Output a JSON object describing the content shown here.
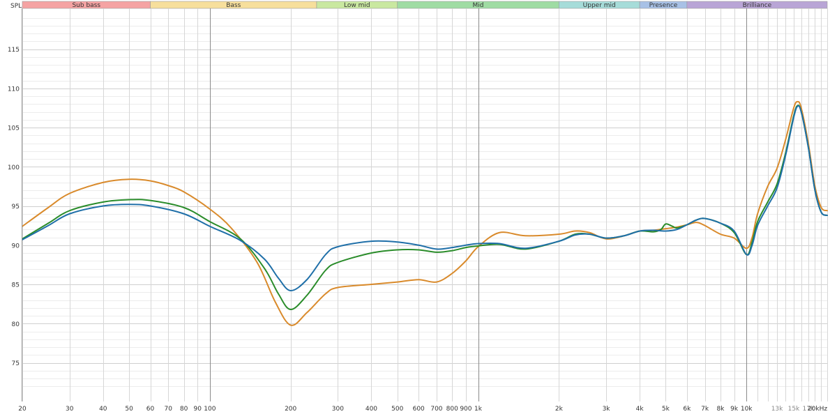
{
  "chart_data": {
    "type": "line",
    "ylabel": "SPL",
    "x_scale": "log",
    "xlim": [
      20,
      20000
    ],
    "ylim": [
      70,
      120
    ],
    "grid": true,
    "legend": "none",
    "bands": [
      {
        "label": "Sub bass",
        "from": 20,
        "to": 60,
        "color": "#f5a3a3"
      },
      {
        "label": "Bass",
        "from": 60,
        "to": 250,
        "color": "#f7df9c"
      },
      {
        "label": "Low mid",
        "from": 250,
        "to": 500,
        "color": "#c9e8a0"
      },
      {
        "label": "Mid",
        "from": 500,
        "to": 2000,
        "color": "#9fdca3"
      },
      {
        "label": "Upper mid",
        "from": 2000,
        "to": 4000,
        "color": "#a6dcd9"
      },
      {
        "label": "Presence",
        "from": 4000,
        "to": 6000,
        "color": "#a8c1e6"
      },
      {
        "label": "Brilliance",
        "from": 6000,
        "to": 20000,
        "color": "#b9a5d6"
      }
    ],
    "y_ticks": [
      {
        "value": 75,
        "label": "75"
      },
      {
        "value": 80,
        "label": "80"
      },
      {
        "value": 85,
        "label": "85"
      },
      {
        "value": 90,
        "label": "90"
      },
      {
        "value": 95,
        "label": "95"
      },
      {
        "value": 100,
        "label": "100"
      },
      {
        "value": 105,
        "label": "105"
      },
      {
        "value": 110,
        "label": "110"
      },
      {
        "value": 115,
        "label": "115"
      }
    ],
    "x_ticks": [
      {
        "value": 20,
        "label": "20"
      },
      {
        "value": 30,
        "label": "30"
      },
      {
        "value": 40,
        "label": "40"
      },
      {
        "value": 50,
        "label": "50"
      },
      {
        "value": 60,
        "label": "60"
      },
      {
        "value": 70,
        "label": "70"
      },
      {
        "value": 80,
        "label": "80"
      },
      {
        "value": 90,
        "label": "90"
      },
      {
        "value": 100,
        "label": "100"
      },
      {
        "value": 200,
        "label": "200"
      },
      {
        "value": 300,
        "label": "300"
      },
      {
        "value": 400,
        "label": "400"
      },
      {
        "value": 500,
        "label": "500"
      },
      {
        "value": 600,
        "label": "600"
      },
      {
        "value": 700,
        "label": "700"
      },
      {
        "value": 800,
        "label": "800"
      },
      {
        "value": 900,
        "label": "900"
      },
      {
        "value": 1000,
        "label": "1k"
      },
      {
        "value": 2000,
        "label": "2k"
      },
      {
        "value": 3000,
        "label": "3k"
      },
      {
        "value": 4000,
        "label": "4k"
      },
      {
        "value": 5000,
        "label": "5k"
      },
      {
        "value": 6000,
        "label": "6k"
      },
      {
        "value": 7000,
        "label": "7k"
      },
      {
        "value": 8000,
        "label": "8k"
      },
      {
        "value": 9000,
        "label": "9k"
      },
      {
        "value": 10000,
        "label": "10k"
      },
      {
        "value": 13000,
        "label": "13k",
        "light": true
      },
      {
        "value": 15000,
        "label": "15k",
        "light": true
      },
      {
        "value": 17000,
        "label": "17k",
        "light": true
      },
      {
        "value": 20000,
        "label": "20kHz"
      }
    ],
    "x_major_lines": [
      100,
      1000,
      10000
    ],
    "x_minor_lines": [
      11000,
      12000,
      13000,
      14000,
      15000,
      16000,
      17000,
      18000,
      19000
    ],
    "series": [
      {
        "color": "#d98a2b",
        "points": [
          [
            20,
            92.4
          ],
          [
            25,
            94.8
          ],
          [
            30,
            96.6
          ],
          [
            40,
            98.0
          ],
          [
            50,
            98.4
          ],
          [
            60,
            98.2
          ],
          [
            70,
            97.6
          ],
          [
            80,
            96.8
          ],
          [
            100,
            94.6
          ],
          [
            120,
            92.2
          ],
          [
            150,
            87.8
          ],
          [
            175,
            82.8
          ],
          [
            200,
            79.8
          ],
          [
            230,
            81.4
          ],
          [
            270,
            83.8
          ],
          [
            300,
            84.6
          ],
          [
            400,
            85.0
          ],
          [
            500,
            85.3
          ],
          [
            600,
            85.6
          ],
          [
            700,
            85.3
          ],
          [
            800,
            86.4
          ],
          [
            900,
            88.0
          ],
          [
            1000,
            89.8
          ],
          [
            1200,
            91.6
          ],
          [
            1500,
            91.2
          ],
          [
            2000,
            91.4
          ],
          [
            2300,
            91.8
          ],
          [
            2600,
            91.6
          ],
          [
            3000,
            90.8
          ],
          [
            3500,
            91.2
          ],
          [
            4000,
            91.8
          ],
          [
            4500,
            91.9
          ],
          [
            5000,
            92.1
          ],
          [
            5500,
            92.3
          ],
          [
            6000,
            92.6
          ],
          [
            6500,
            92.9
          ],
          [
            7000,
            92.5
          ],
          [
            8000,
            91.4
          ],
          [
            9000,
            90.9
          ],
          [
            10000,
            89.6
          ],
          [
            10500,
            91.0
          ],
          [
            11000,
            94.0
          ],
          [
            12000,
            97.5
          ],
          [
            13000,
            99.8
          ],
          [
            14000,
            103.5
          ],
          [
            15000,
            107.5
          ],
          [
            15500,
            108.3
          ],
          [
            16000,
            107.5
          ],
          [
            17000,
            103.0
          ],
          [
            18000,
            97.5
          ],
          [
            19000,
            94.8
          ],
          [
            20000,
            94.4
          ]
        ]
      },
      {
        "color": "#2a8c2a",
        "points": [
          [
            20,
            90.8
          ],
          [
            25,
            92.8
          ],
          [
            30,
            94.4
          ],
          [
            40,
            95.5
          ],
          [
            50,
            95.8
          ],
          [
            60,
            95.7
          ],
          [
            80,
            94.8
          ],
          [
            100,
            93.0
          ],
          [
            130,
            90.8
          ],
          [
            160,
            87.0
          ],
          [
            180,
            83.8
          ],
          [
            200,
            81.8
          ],
          [
            230,
            83.6
          ],
          [
            270,
            86.8
          ],
          [
            300,
            87.8
          ],
          [
            400,
            89.0
          ],
          [
            500,
            89.4
          ],
          [
            600,
            89.4
          ],
          [
            700,
            89.1
          ],
          [
            800,
            89.3
          ],
          [
            900,
            89.7
          ],
          [
            1000,
            89.9
          ],
          [
            1200,
            90.1
          ],
          [
            1500,
            89.5
          ],
          [
            2000,
            90.5
          ],
          [
            2300,
            91.4
          ],
          [
            2600,
            91.4
          ],
          [
            3000,
            90.9
          ],
          [
            3500,
            91.2
          ],
          [
            4000,
            91.8
          ],
          [
            4500,
            91.7
          ],
          [
            4800,
            92.0
          ],
          [
            5000,
            92.7
          ],
          [
            5300,
            92.4
          ],
          [
            5500,
            92.2
          ],
          [
            6000,
            92.6
          ],
          [
            6500,
            93.2
          ],
          [
            7000,
            93.4
          ],
          [
            8000,
            92.8
          ],
          [
            9000,
            91.6
          ],
          [
            10000,
            88.8
          ],
          [
            10500,
            90.4
          ],
          [
            11000,
            93.0
          ],
          [
            12000,
            95.5
          ],
          [
            13000,
            97.8
          ],
          [
            14000,
            101.8
          ],
          [
            15000,
            106.5
          ],
          [
            15500,
            107.8
          ],
          [
            16000,
            107.0
          ],
          [
            17000,
            102.5
          ],
          [
            18000,
            97.0
          ],
          [
            19000,
            94.2
          ],
          [
            20000,
            93.8
          ]
        ]
      },
      {
        "color": "#1f6fa8",
        "points": [
          [
            20,
            90.7
          ],
          [
            25,
            92.5
          ],
          [
            30,
            94.0
          ],
          [
            40,
            95.0
          ],
          [
            50,
            95.2
          ],
          [
            60,
            95.0
          ],
          [
            80,
            94.0
          ],
          [
            100,
            92.4
          ],
          [
            130,
            90.6
          ],
          [
            160,
            88.2
          ],
          [
            180,
            85.8
          ],
          [
            200,
            84.2
          ],
          [
            230,
            85.6
          ],
          [
            270,
            88.8
          ],
          [
            300,
            89.8
          ],
          [
            400,
            90.5
          ],
          [
            500,
            90.4
          ],
          [
            600,
            90.0
          ],
          [
            700,
            89.5
          ],
          [
            800,
            89.7
          ],
          [
            900,
            90.0
          ],
          [
            1000,
            90.2
          ],
          [
            1200,
            90.2
          ],
          [
            1500,
            89.6
          ],
          [
            2000,
            90.5
          ],
          [
            2300,
            91.3
          ],
          [
            2600,
            91.4
          ],
          [
            3000,
            90.9
          ],
          [
            3500,
            91.2
          ],
          [
            4000,
            91.8
          ],
          [
            4500,
            91.9
          ],
          [
            5000,
            91.8
          ],
          [
            5500,
            92.0
          ],
          [
            6000,
            92.6
          ],
          [
            6500,
            93.2
          ],
          [
            7000,
            93.4
          ],
          [
            8000,
            92.8
          ],
          [
            9000,
            91.8
          ],
          [
            10000,
            88.8
          ],
          [
            10500,
            90.0
          ],
          [
            11000,
            92.5
          ],
          [
            12000,
            95.0
          ],
          [
            13000,
            97.3
          ],
          [
            14000,
            101.5
          ],
          [
            15000,
            106.3
          ],
          [
            15500,
            107.7
          ],
          [
            16000,
            107.0
          ],
          [
            17000,
            102.5
          ],
          [
            18000,
            97.0
          ],
          [
            19000,
            94.2
          ],
          [
            20000,
            93.8
          ]
        ]
      }
    ]
  }
}
